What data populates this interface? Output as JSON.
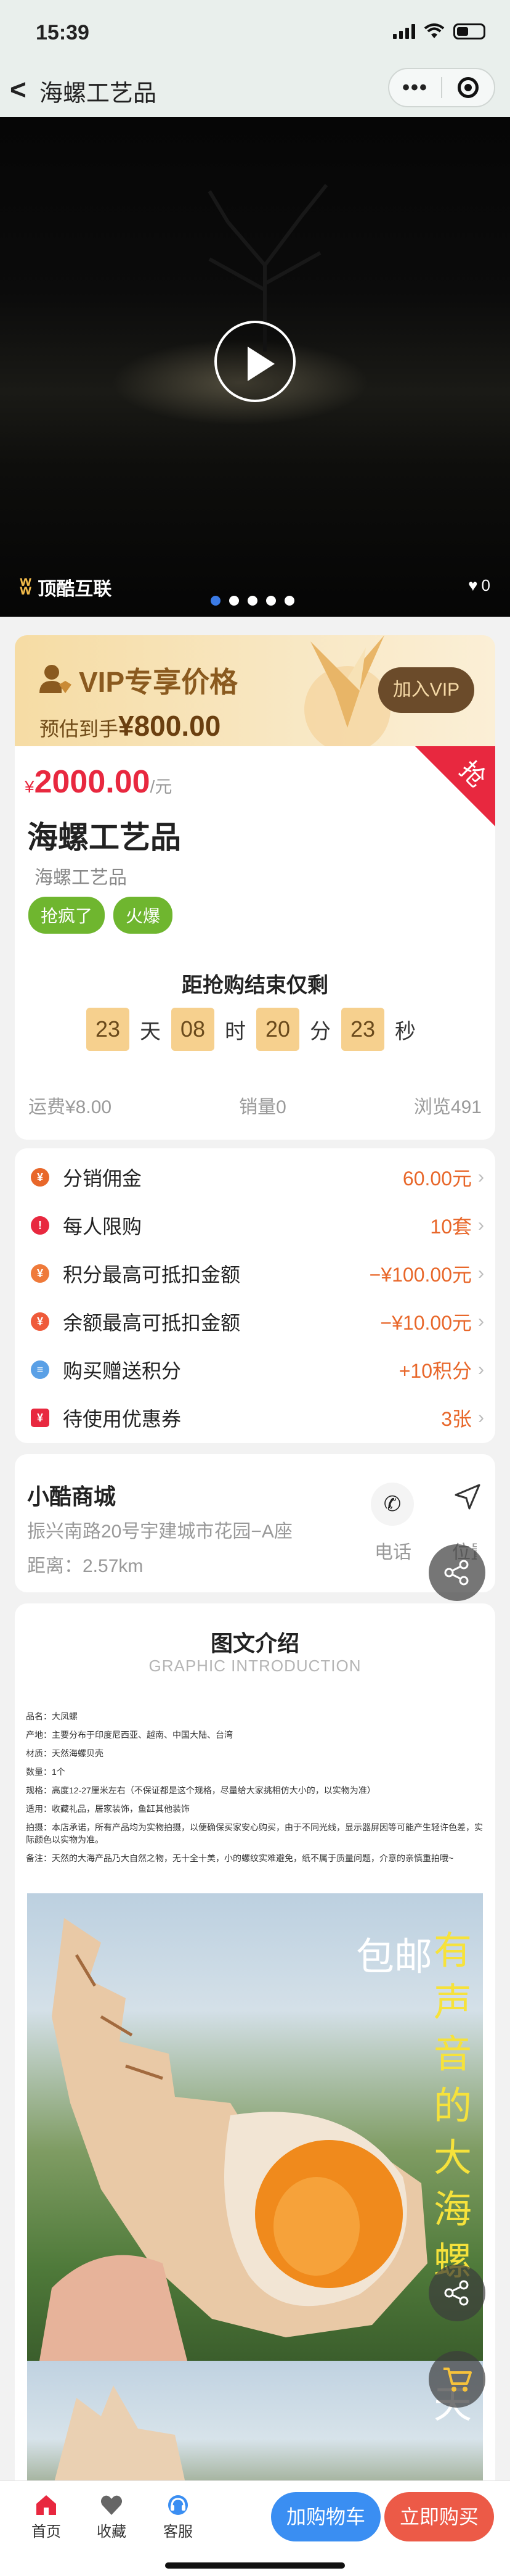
{
  "status_bar": {
    "time": "15:39"
  },
  "nav": {
    "back_glyph": "<",
    "title": "海螺工艺品",
    "more_glyph": "•••"
  },
  "video": {
    "brand": "顶酷互联",
    "like_count": "0",
    "slide_count": 5,
    "active_slide": 0
  },
  "vip": {
    "title": "VIP专享价格",
    "estimate_label": "预估到手",
    "estimate_price": "¥800.00",
    "join_button": "加入VIP"
  },
  "product": {
    "currency": "¥",
    "price": "2000.00",
    "unit": "/元",
    "rush_badge": "抢",
    "title": "海螺工艺品",
    "subtitle": "海螺工艺品",
    "tags": [
      "抢疯了",
      "火爆"
    ]
  },
  "countdown": {
    "label": "距抢购结束仅剩",
    "days": "23",
    "days_unit": "天",
    "hours": "08",
    "hours_unit": "时",
    "minutes": "20",
    "minutes_unit": "分",
    "seconds": "23",
    "seconds_unit": "秒"
  },
  "stats": {
    "shipping": "运费¥8.00",
    "sales": "销量0",
    "views": "浏览491"
  },
  "benefits": [
    {
      "label": "分销佣金",
      "value": "60.00元",
      "color": "#e8672a"
    },
    {
      "label": "每人限购",
      "value": "10套",
      "color": "#e8283f"
    },
    {
      "label": "积分最高可抵扣金额",
      "value": "−¥100.00元",
      "color": "#ef7a3a"
    },
    {
      "label": "余额最高可抵扣金额",
      "value": "−¥10.00元",
      "color": "#ef5a3a"
    },
    {
      "label": "购买赠送积分",
      "value": "+10积分",
      "color": "#5aa0e6"
    },
    {
      "label": "待使用优惠券",
      "value": "3张",
      "color": "#e8283f"
    }
  ],
  "store": {
    "name": "小酷商城",
    "address": "振兴南路20号宇建城市花园−A座",
    "distance": "距离：2.57km",
    "phone_label": "电话",
    "location_label": "位置"
  },
  "intro": {
    "title": "图文介绍",
    "subtitle": "GRAPHIC INTRODUCTION",
    "specs": [
      "品名：大凤螺",
      "产地：主要分布于印度尼西亚、越南、中国大陆、台湾",
      "材质：天然海螺贝壳",
      "数量：1个",
      "规格：高度12-27厘米左右（不保证都是这个规格，尽量给大家挑相仿大小的，以实物为准）",
      "适用：收藏礼品，居家装饰，鱼缸其他装饰",
      "拍摄：本店承诺，所有产品均为实物拍摄，以便确保买家安心购买，由于不同光线，显示器屏因等可能产生轻许色差，实际颜色以实物为准。",
      "备注：天然的大海产品乃大自然之物，无十全十美，小的螺纹实难避免，纸不属于质量问题，介意的亲慎重拍哦~"
    ],
    "overlay_white": "包邮",
    "overlay_yellow": "有声音的大海螺",
    "overlay_tail": "天"
  },
  "bottom_bar": {
    "tabs": [
      {
        "label": "首页",
        "color": "#e8283f"
      },
      {
        "label": "收藏",
        "color": "#666666"
      },
      {
        "label": "客服",
        "color": "#3a8ef2"
      }
    ],
    "add_to_cart": "加购物车",
    "buy_now": "立即购买"
  }
}
